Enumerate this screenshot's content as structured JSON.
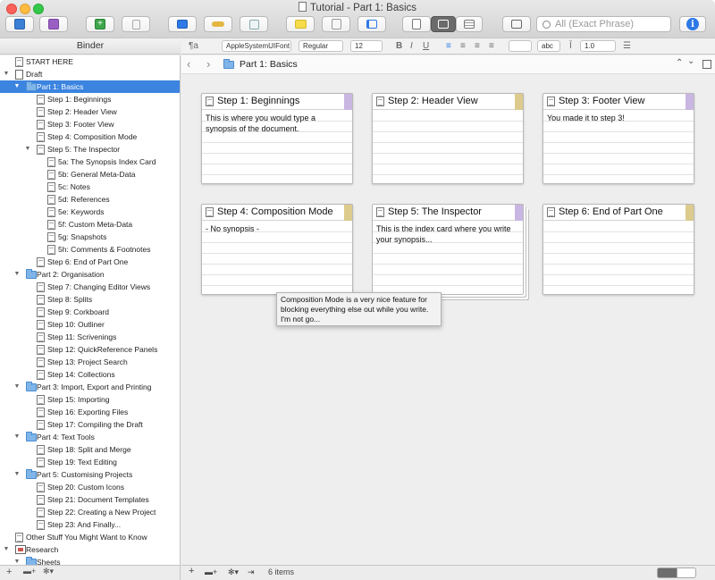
{
  "window": {
    "title": "Tutorial - Part 1: Basics"
  },
  "toolbar": {
    "search_placeholder": "All (Exact Phrase)",
    "info_label": "i"
  },
  "binder": {
    "header": "Binder"
  },
  "format_bar": {
    "paragraph_style": "¶a",
    "font": "AppleSystemUIFont",
    "weight": "Regular",
    "size": "12",
    "bold": "B",
    "italic": "I",
    "underline": "U",
    "text_color_sample": "abc",
    "line_spacing": "1.0"
  },
  "binder_items": [
    {
      "label": "START HERE",
      "level": 0,
      "icon": "document",
      "toggle": ""
    },
    {
      "label": "Draft",
      "level": 0,
      "icon": "draft",
      "toggle": "▼"
    },
    {
      "label": "Part 1: Basics",
      "level": 1,
      "icon": "folder",
      "toggle": "▼",
      "selected": true
    },
    {
      "label": "Step 1: Beginnings",
      "level": 2,
      "icon": "document",
      "toggle": ""
    },
    {
      "label": "Step 2: Header View",
      "level": 2,
      "icon": "document",
      "toggle": ""
    },
    {
      "label": "Step 3: Footer View",
      "level": 2,
      "icon": "document",
      "toggle": ""
    },
    {
      "label": "Step 4: Composition Mode",
      "level": 2,
      "icon": "document",
      "toggle": ""
    },
    {
      "label": "Step 5: The Inspector",
      "level": 2,
      "icon": "document-stack",
      "toggle": "▼"
    },
    {
      "label": "5a: The Synopsis Index Card",
      "level": 3,
      "icon": "document",
      "toggle": ""
    },
    {
      "label": "5b: General Meta-Data",
      "level": 3,
      "icon": "document",
      "toggle": ""
    },
    {
      "label": "5c: Notes",
      "level": 3,
      "icon": "document",
      "toggle": ""
    },
    {
      "label": "5d: References",
      "level": 3,
      "icon": "document",
      "toggle": ""
    },
    {
      "label": "5e: Keywords",
      "level": 3,
      "icon": "document",
      "toggle": ""
    },
    {
      "label": "5f: Custom Meta-Data",
      "level": 3,
      "icon": "document",
      "toggle": ""
    },
    {
      "label": "5g: Snapshots",
      "level": 3,
      "icon": "document",
      "toggle": ""
    },
    {
      "label": "5h: Comments & Footnotes",
      "level": 3,
      "icon": "document",
      "toggle": ""
    },
    {
      "label": "Step 6: End of Part One",
      "level": 2,
      "icon": "document",
      "toggle": ""
    },
    {
      "label": "Part 2: Organisation",
      "level": 1,
      "icon": "folder",
      "toggle": "▼"
    },
    {
      "label": "Step 7: Changing Editor Views",
      "level": 2,
      "icon": "document",
      "toggle": ""
    },
    {
      "label": "Step 8: Splits",
      "level": 2,
      "icon": "document",
      "toggle": ""
    },
    {
      "label": "Step 9: Corkboard",
      "level": 2,
      "icon": "document",
      "toggle": ""
    },
    {
      "label": "Step 10: Outliner",
      "level": 2,
      "icon": "document",
      "toggle": ""
    },
    {
      "label": "Step 11: Scrivenings",
      "level": 2,
      "icon": "document",
      "toggle": ""
    },
    {
      "label": "Step 12: QuickReference Panels",
      "level": 2,
      "icon": "document",
      "toggle": ""
    },
    {
      "label": "Step 13: Project Search",
      "level": 2,
      "icon": "document",
      "toggle": ""
    },
    {
      "label": "Step 14: Collections",
      "level": 2,
      "icon": "document",
      "toggle": ""
    },
    {
      "label": "Part 3: Import, Export and Printing",
      "level": 1,
      "icon": "folder",
      "toggle": "▼"
    },
    {
      "label": "Step 15: Importing",
      "level": 2,
      "icon": "document",
      "toggle": ""
    },
    {
      "label": "Step 16: Exporting Files",
      "level": 2,
      "icon": "document",
      "toggle": ""
    },
    {
      "label": "Step 17: Compiling the Draft",
      "level": 2,
      "icon": "document",
      "toggle": ""
    },
    {
      "label": "Part 4: Text Tools",
      "level": 1,
      "icon": "folder",
      "toggle": "▼"
    },
    {
      "label": "Step 18: Split and Merge",
      "level": 2,
      "icon": "document",
      "toggle": ""
    },
    {
      "label": "Step 19: Text Editing",
      "level": 2,
      "icon": "document",
      "toggle": ""
    },
    {
      "label": "Part 5: Customising Projects",
      "level": 1,
      "icon": "folder",
      "toggle": "▼"
    },
    {
      "label": "Step 20: Custom Icons",
      "level": 2,
      "icon": "document",
      "toggle": ""
    },
    {
      "label": "Step 21: Document Templates",
      "level": 2,
      "icon": "document",
      "toggle": ""
    },
    {
      "label": "Step 22: Creating a New Project",
      "level": 2,
      "icon": "document",
      "toggle": ""
    },
    {
      "label": "Step 23: And Finally...",
      "level": 2,
      "icon": "document",
      "toggle": ""
    },
    {
      "label": "Other Stuff You Might Want to Know",
      "level": 0,
      "icon": "document",
      "toggle": ""
    },
    {
      "label": "Research",
      "level": 0,
      "icon": "research",
      "toggle": "▼"
    },
    {
      "label": "Sheets",
      "level": 1,
      "icon": "folder",
      "toggle": "▼"
    }
  ],
  "editor": {
    "breadcrumb": "Part 1: Basics",
    "item_count": "6 items"
  },
  "cards": [
    {
      "title": "Step 1: Beginnings",
      "synopsis": "This is where you would type a synopsis of the document.",
      "label_color": "#c9b6e2"
    },
    {
      "title": "Step 2: Header View",
      "synopsis": "",
      "label_color": "#dccb8c"
    },
    {
      "title": "Step 3: Footer View",
      "synopsis": "You made it to step 3!",
      "label_color": "#c9b6e2"
    },
    {
      "title": "Step 4: Composition Mode",
      "synopsis": "- No synopsis -",
      "label_color": "#dccb8c"
    },
    {
      "title": "Step 5: The Inspector",
      "synopsis": "This is the index card where you write your synopsis...",
      "label_color": "#c9b6e2"
    },
    {
      "title": "Step 6: End of Part One",
      "synopsis": "",
      "label_color": "#dccb8c"
    }
  ],
  "tooltip": {
    "text": "Composition Mode is a very nice feature for blocking everything else out while you write. I'm not go..."
  },
  "colors": {
    "selection": "#3b84e0",
    "corkboard": "#eeeeee",
    "card_label_purple": "#c9b6e2",
    "card_label_gold": "#dccb8c"
  }
}
